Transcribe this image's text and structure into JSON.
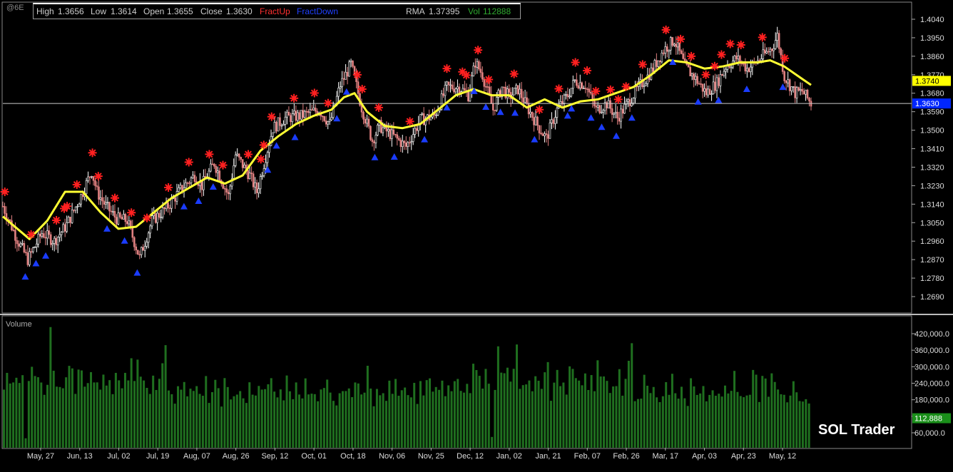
{
  "symbol": "@6E",
  "info_bar": {
    "high_label": "High",
    "high": "1.3656",
    "low_label": "Low",
    "low": "1.3614",
    "open_label": "Open",
    "open": "1.3655",
    "close_label": "Close",
    "close": "1.3630",
    "fractup_label": "FractUp",
    "fractdown_label": "FractDown",
    "rma_label": "RMA",
    "rma": "1.37395",
    "vol_label": "Vol",
    "vol": "112888"
  },
  "colors": {
    "background": "#000000",
    "bull_candle": "#ffffff",
    "bear_candle": "#e08080",
    "rma_line": "#ffff33",
    "fract_up": "#ff2020",
    "fract_down": "#1a3cff",
    "volume_bar": "#1f6f1f",
    "rma_badge": "#ffff00",
    "price_badge": "#0026ff",
    "vol_badge": "#1a8f1a",
    "crosshair": "#cccccc"
  },
  "brand": "SOL Trader",
  "chart_data": [
    {
      "type": "candlestick",
      "title": "@6E",
      "ylim": [
        1.262,
        1.411
      ],
      "y_ticks": [
        1.269,
        1.278,
        1.287,
        1.296,
        1.305,
        1.314,
        1.323,
        1.332,
        1.341,
        1.35,
        1.359,
        1.368,
        1.377,
        1.386,
        1.395,
        1.404
      ],
      "y_tick_labels": [
        "1.2690",
        "1.2780",
        "1.2870",
        "1.2960",
        "1.3050",
        "1.3140",
        "1.3230",
        "1.3320",
        "1.3410",
        "1.3500",
        "1.3590",
        "1.3680",
        "1.3770",
        "1.3860",
        "1.3950",
        "1.4040"
      ],
      "x_labels": [
        "May, 27",
        "Jun, 13",
        "Jul, 02",
        "Jul, 19",
        "Aug, 07",
        "Aug, 26",
        "Sep, 12",
        "Oct, 01",
        "Oct, 18",
        "Nov, 06",
        "Nov, 25",
        "Dec, 12",
        "Jan, 02",
        "Jan, 21",
        "Feb, 07",
        "Feb, 26",
        "Mar, 17",
        "Apr, 03",
        "Apr, 23",
        "May, 12"
      ],
      "bar_count": 262,
      "trend_close": [
        [
          0,
          1.313
        ],
        [
          8,
          1.297
        ],
        [
          14,
          1.287
        ],
        [
          22,
          1.3
        ],
        [
          29,
          1.296
        ],
        [
          36,
          1.304
        ],
        [
          44,
          1.318
        ],
        [
          50,
          1.33
        ],
        [
          53,
          1.32
        ],
        [
          58,
          1.313
        ],
        [
          64,
          1.307
        ],
        [
          70,
          1.306
        ],
        [
          77,
          1.288
        ],
        [
          84,
          1.306
        ],
        [
          92,
          1.312
        ],
        [
          101,
          1.322
        ],
        [
          108,
          1.328
        ],
        [
          112,
          1.323
        ],
        [
          119,
          1.334
        ],
        [
          127,
          1.318
        ],
        [
          131,
          1.338
        ],
        [
          139,
          1.328
        ],
        [
          143,
          1.32
        ],
        [
          152,
          1.351
        ],
        [
          159,
          1.356
        ],
        [
          168,
          1.357
        ],
        [
          178,
          1.36
        ],
        [
          184,
          1.353
        ],
        [
          190,
          1.372
        ],
        [
          196,
          1.382
        ],
        [
          202,
          1.361
        ],
        [
          208,
          1.345
        ],
        [
          212,
          1.352
        ],
        [
          220,
          1.347
        ],
        [
          227,
          1.342
        ],
        [
          235,
          1.355
        ],
        [
          243,
          1.357
        ],
        [
          250,
          1.371
        ],
        [
          257,
          1.371
        ],
        [
          262,
          1.367
        ],
        [
          266,
          1.383
        ],
        [
          270,
          1.377
        ],
        [
          276,
          1.36
        ],
        [
          281,
          1.371
        ],
        [
          285,
          1.366
        ],
        [
          290,
          1.37
        ],
        [
          296,
          1.36
        ],
        [
          302,
          1.351
        ],
        [
          306,
          1.346
        ],
        [
          312,
          1.36
        ],
        [
          318,
          1.367
        ],
        [
          322,
          1.374
        ],
        [
          328,
          1.372
        ],
        [
          334,
          1.36
        ],
        [
          340,
          1.363
        ],
        [
          346,
          1.356
        ],
        [
          350,
          1.361
        ],
        [
          358,
          1.371
        ],
        [
          362,
          1.375
        ],
        [
          366,
          1.38
        ],
        [
          372,
          1.389
        ],
        [
          378,
          1.394
        ],
        [
          384,
          1.381
        ],
        [
          390,
          1.375
        ],
        [
          396,
          1.368
        ],
        [
          402,
          1.373
        ],
        [
          407,
          1.381
        ],
        [
          413,
          1.385
        ],
        [
          419,
          1.38
        ],
        [
          424,
          1.383
        ],
        [
          429,
          1.387
        ],
        [
          433,
          1.39
        ],
        [
          436,
          1.396
        ],
        [
          440,
          1.376
        ],
        [
          446,
          1.368
        ],
        [
          450,
          1.369
        ],
        [
          455,
          1.363
        ]
      ],
      "rma": {
        "name": "RMA",
        "last": 1.37395,
        "points": [
          [
            0,
            1.308
          ],
          [
            15,
            1.297
          ],
          [
            25,
            1.306
          ],
          [
            35,
            1.32
          ],
          [
            45,
            1.32
          ],
          [
            55,
            1.31
          ],
          [
            65,
            1.302
          ],
          [
            75,
            1.303
          ],
          [
            85,
            1.31
          ],
          [
            95,
            1.317
          ],
          [
            105,
            1.322
          ],
          [
            115,
            1.327
          ],
          [
            125,
            1.324
          ],
          [
            135,
            1.328
          ],
          [
            145,
            1.34
          ],
          [
            155,
            1.347
          ],
          [
            165,
            1.353
          ],
          [
            175,
            1.357
          ],
          [
            185,
            1.36
          ],
          [
            192,
            1.366
          ],
          [
            198,
            1.368
          ],
          [
            205,
            1.359
          ],
          [
            215,
            1.352
          ],
          [
            225,
            1.351
          ],
          [
            235,
            1.353
          ],
          [
            245,
            1.36
          ],
          [
            255,
            1.367
          ],
          [
            265,
            1.37
          ],
          [
            275,
            1.367
          ],
          [
            285,
            1.367
          ],
          [
            295,
            1.361
          ],
          [
            305,
            1.365
          ],
          [
            315,
            1.361
          ],
          [
            325,
            1.364
          ],
          [
            335,
            1.365
          ],
          [
            345,
            1.368
          ],
          [
            355,
            1.371
          ],
          [
            365,
            1.377
          ],
          [
            375,
            1.384
          ],
          [
            385,
            1.383
          ],
          [
            395,
            1.38
          ],
          [
            405,
            1.381
          ],
          [
            415,
            1.383
          ],
          [
            425,
            1.383
          ],
          [
            432,
            1.384
          ],
          [
            440,
            1.381
          ],
          [
            450,
            1.375
          ],
          [
            455,
            1.372
          ]
        ]
      },
      "fract_up_bars": [
        2,
        29,
        55,
        63,
        66,
        76,
        92,
        98,
        115,
        132,
        148,
        170,
        191,
        212,
        226,
        252,
        265,
        268,
        276,
        299,
        320,
        334,
        364,
        369,
        386,
        418,
        456,
        472,
        476,
        488,
        499,
        525,
        551,
        571,
        588,
        600,
        609,
        624,
        632,
        640,
        657,
        681,
        696,
        707,
        722,
        731,
        738,
        747,
        758,
        780,
        803
      ],
      "fract_down_bars": [
        23,
        34,
        44,
        107,
        125,
        138,
        186,
        201,
        216,
        272,
        281,
        300,
        343,
        353,
        382,
        402,
        433,
        456,
        484,
        496,
        511,
        526,
        546,
        580,
        584,
        604,
        615,
        630,
        646,
        688,
        714,
        735,
        764,
        801
      ],
      "current_price": 1.363,
      "current_price_label": "1.3630",
      "rma_badge_label": "1.3740"
    },
    {
      "type": "bar",
      "title": "Volume",
      "series": [
        {
          "name": "Vol",
          "last": 112888
        }
      ],
      "ylim": [
        0,
        450000
      ],
      "y_ticks": [
        60000,
        120000,
        180000,
        240000,
        300000,
        360000,
        420000
      ],
      "y_tick_labels": [
        "60,000.0",
        "120,000.0",
        "180,000.0",
        "240,000.0",
        "300,000.0",
        "360,000.0",
        "420,000.0"
      ],
      "vol_badge_label": "112,888",
      "approx_values": [
        230000,
        280000,
        260000,
        285000,
        250000,
        262000,
        248000,
        42000,
        220000,
        345000,
        310000,
        245000,
        262000,
        225000,
        270000,
        410000,
        250000,
        240000,
        262000,
        255000,
        230000,
        305000,
        270000,
        210000,
        290000,
        280000,
        200000,
        240000,
        255000,
        270000,
        215000,
        190000,
        280000,
        255000,
        258000,
        230000,
        262000,
        245000,
        215000,
        250000,
        225000,
        340000,
        280000,
        305000,
        235000,
        225000,
        220000,
        200000,
        265000,
        200000,
        245000,
        310000,
        350000,
        200000,
        215000,
        195000,
        255000,
        240000,
        220000,
        200000,
        210000,
        195000,
        212000,
        225000,
        215000,
        245000,
        195000,
        210000,
        230000,
        205000,
        180000,
        275000,
        210000,
        190000,
        185000,
        205000,
        195000,
        200000,
        190000,
        225000,
        195000,
        205000,
        215000,
        190000,
        220000,
        270000,
        230000,
        185000,
        205000,
        200000,
        198000,
        260000,
        245000,
        180000,
        235000,
        230000,
        185000,
        245000,
        215000,
        205000,
        220000,
        200000,
        198000,
        215000,
        225000,
        240000,
        185000,
        175000,
        205000,
        195000,
        222000,
        215000,
        198000,
        225000,
        220000,
        200000,
        185000,
        305000,
        215000,
        178000,
        250000,
        225000,
        185000,
        205000,
        260000,
        200000,
        240000,
        175000,
        210000,
        220000,
        230000,
        195000,
        210000,
        180000,
        255000,
        200000,
        225000,
        300000,
        225000,
        230000,
        205000,
        220000,
        205000,
        215000,
        190000,
        222000,
        240000,
        215000,
        200000,
        210000
      ]
    }
  ]
}
